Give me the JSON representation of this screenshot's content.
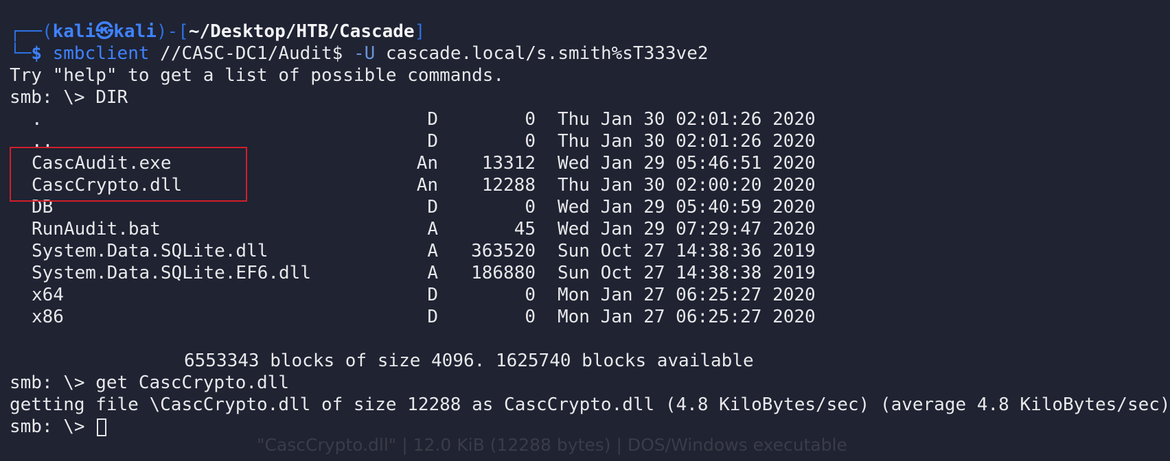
{
  "window": {
    "prompt_user": "kali",
    "prompt_host": "kali",
    "prompt_path": "~/Desktop/HTB/Cascade"
  },
  "command": {
    "program": "smbclient",
    "share": "//CASC-DC1/Audit$",
    "flag": "-U",
    "credentials": "cascade.local/s.smith%sT333ve2"
  },
  "output": {
    "help_hint": "Try \"help\" to get a list of possible commands.",
    "prompt1": "smb: \\> DIR",
    "files": [
      {
        "name": ".",
        "attr": "D",
        "size": "0",
        "date": "Thu Jan 30 02:01:26 2020"
      },
      {
        "name": "..",
        "attr": "D",
        "size": "0",
        "date": "Thu Jan 30 02:01:26 2020"
      },
      {
        "name": "CascAudit.exe",
        "attr": "An",
        "size": "13312",
        "date": "Wed Jan 29 05:46:51 2020"
      },
      {
        "name": "CascCrypto.dll",
        "attr": "An",
        "size": "12288",
        "date": "Thu Jan 30 02:00:20 2020"
      },
      {
        "name": "DB",
        "attr": "D",
        "size": "0",
        "date": "Wed Jan 29 05:40:59 2020"
      },
      {
        "name": "RunAudit.bat",
        "attr": "A",
        "size": "45",
        "date": "Wed Jan 29 07:29:47 2020"
      },
      {
        "name": "System.Data.SQLite.dll",
        "attr": "A",
        "size": "363520",
        "date": "Sun Oct 27 14:38:36 2019"
      },
      {
        "name": "System.Data.SQLite.EF6.dll",
        "attr": "A",
        "size": "186880",
        "date": "Sun Oct 27 14:38:38 2019"
      },
      {
        "name": "x64",
        "attr": "D",
        "size": "0",
        "date": "Mon Jan 27 06:25:27 2020"
      },
      {
        "name": "x86",
        "attr": "D",
        "size": "0",
        "date": "Mon Jan 27 06:25:27 2020"
      }
    ],
    "blocks_summary": "6553343 blocks of size 4096. 1625740 blocks available",
    "prompt2": "smb: \\> get CascCrypto.dll",
    "getting_file": "getting file \\CascCrypto.dll of size 12288 as CascCrypto.dll (4.8 KiloBytes/sec) (average 4.8 KiloBytes/sec)",
    "prompt3": "smb: \\> "
  },
  "tooltip": "\"CascCrypto.dll\" | 12.0 KiB (12288 bytes) | DOS/Windows executable",
  "colors": {
    "background": "#1f2332",
    "highlight_box": "#d11f2a",
    "prompt_blue": "#3f82ff"
  }
}
